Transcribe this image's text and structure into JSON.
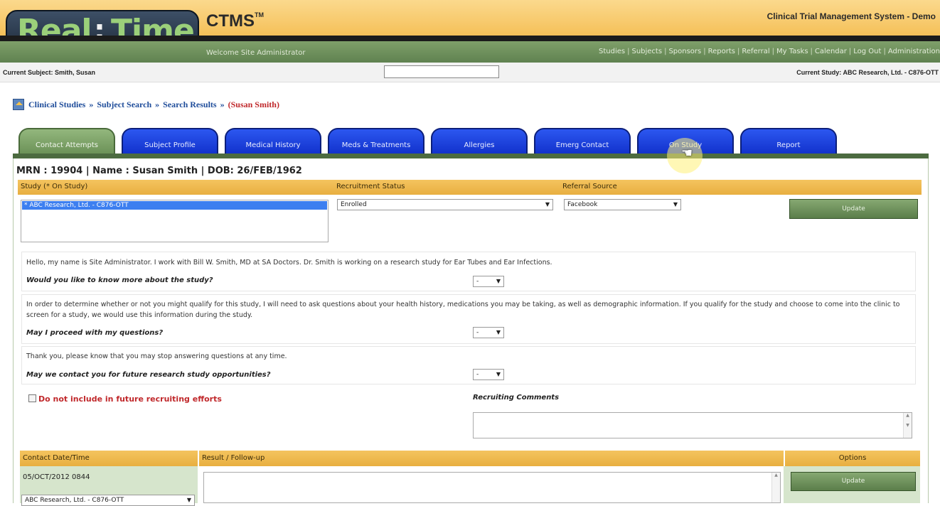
{
  "header": {
    "logo_text": "Real:Time",
    "product": "CTMS",
    "product_mark": "TM",
    "system_title": "Clinical Trial Management System - Demo",
    "welcome": "Welcome Site Administrator"
  },
  "nav_links": [
    "Studies",
    "Subjects",
    "Sponsors",
    "Reports",
    "Referral",
    "My Tasks",
    "Calendar",
    "Log Out",
    "Administration"
  ],
  "infobar": {
    "current_subject": "Current Subject:   Smith, Susan",
    "search_value": "",
    "current_study": "Current Study:   ABC Research, Ltd. - C876-OTT"
  },
  "breadcrumb": {
    "items": [
      "Clinical Studies",
      "Subject Search",
      "Search Results"
    ],
    "separator": "»",
    "current": "(Susan Smith)"
  },
  "tabs": [
    {
      "label": "Contact Attempts",
      "active": true
    },
    {
      "label": "Subject Profile",
      "active": false
    },
    {
      "label": "Medical History",
      "active": false
    },
    {
      "label": "Meds & Treatments",
      "active": false
    },
    {
      "label": "Allergies",
      "active": false
    },
    {
      "label": "Emerg Contact",
      "active": false
    },
    {
      "label": "On Study",
      "active": false
    },
    {
      "label": "Report",
      "active": false
    }
  ],
  "patient": {
    "line": "MRN : 19904 | Name : Susan Smith | DOB: 26/FEB/1962"
  },
  "study_header": {
    "study": "Study (* On Study)",
    "recruitment_status": "Recruitment Status",
    "referral_source": "Referral Source"
  },
  "study_list": [
    "* ABC Research, Ltd. - C876-OTT"
  ],
  "recruitment_status_value": "Enrolled",
  "referral_source_value": "Facebook",
  "update_label": "Update",
  "questions": [
    {
      "intro": "Hello, my name is Site Administrator. I work with Bill W. Smith, MD at SA Doctors. Dr. Smith is working on a research study for Ear Tubes and Ear Infections.",
      "question": "Would you like to know more about the study?",
      "answer": "-"
    },
    {
      "intro": "In order to determine whether or not you might qualify for this study, I will need to ask questions about your health history, medications you may be taking, as well as demographic information. If you qualify for the study and choose to come into the clinic to screen for a study, we would use this information during the study.",
      "question": "May I proceed with my questions?",
      "answer": "-"
    },
    {
      "intro": "Thank you, please know that you may stop answering questions at any time.",
      "question": "May we contact you for future research study opportunities?",
      "answer": "-"
    }
  ],
  "exclude_label": "Do not include in future recruiting efforts",
  "exclude_checked": false,
  "recruiting_comments_label": "Recruiting Comments",
  "recruiting_comments_value": "",
  "contact_table": {
    "headers": [
      "Contact Date/Time",
      "Result / Follow-up",
      "Options"
    ],
    "rows": [
      {
        "date_time": "05/OCT/2012 0844",
        "study": "ABC Research, Ltd. - C876-OTT",
        "result": "",
        "option": "Update"
      }
    ]
  },
  "colors": {
    "header_gold": "#f5c15a",
    "nav_green": "#6c9258",
    "tab_blue": "#1a3fe0",
    "accent_red": "#c0282b",
    "link_blue": "#1e4c9a"
  }
}
